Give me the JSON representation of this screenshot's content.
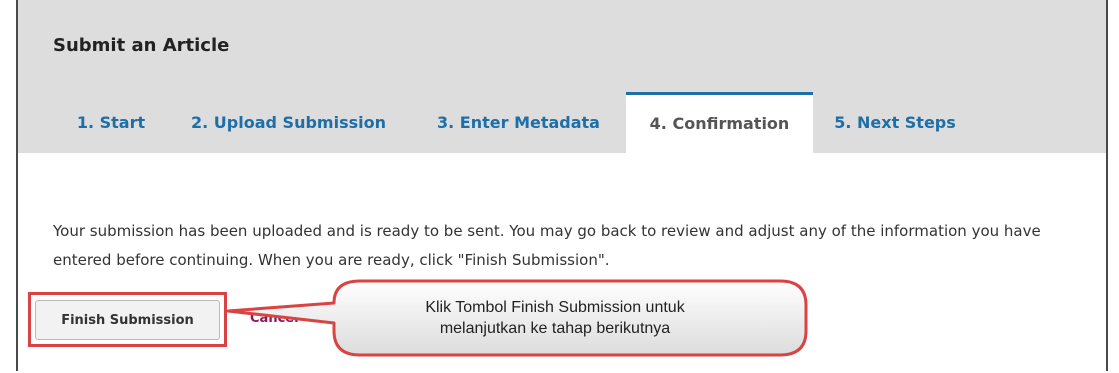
{
  "page": {
    "title": "Submit an Article"
  },
  "tabs": [
    {
      "label": "1. Start",
      "active": false
    },
    {
      "label": "2. Upload Submission",
      "active": false
    },
    {
      "label": "3. Enter Metadata",
      "active": false
    },
    {
      "label": "4. Confirmation",
      "active": true
    },
    {
      "label": "5. Next Steps",
      "active": false
    }
  ],
  "content": {
    "message": "Your submission has been uploaded and is ready to be sent. You may go back to review and adjust any of the information you have entered before continuing. When you are ready, click \"Finish Submission\".",
    "finish_label": "Finish Submission",
    "cancel_label": "Cancel"
  },
  "annotation": {
    "text_line1": "Klik Tombol Finish Submission untuk",
    "text_line2": "melanjutkan ke tahap berikutnya"
  },
  "colors": {
    "header_bg": "#dddddd",
    "tab_link": "#1e6fa8",
    "cancel_link": "#8a1a5a",
    "annotation_stroke": "#d94343"
  }
}
